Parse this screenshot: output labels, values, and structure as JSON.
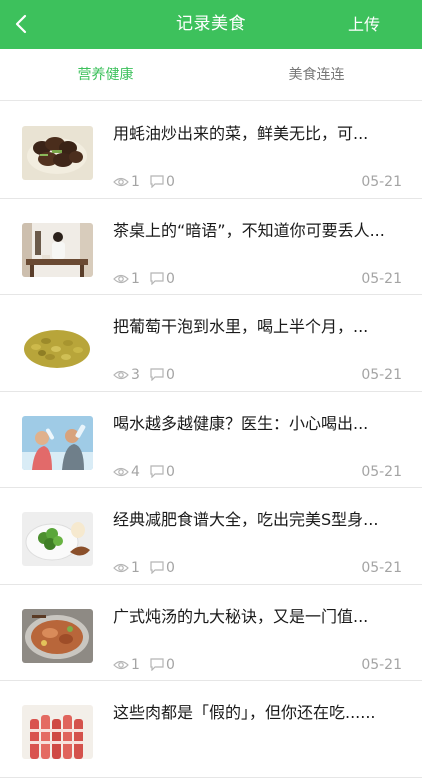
{
  "header": {
    "title": "记录美食",
    "upload_label": "上传"
  },
  "tabs": [
    {
      "label": "营养健康",
      "active": true
    },
    {
      "label": "美食连连",
      "active": false
    }
  ],
  "colors": {
    "accent": "#3dc15c",
    "meta": "#a4a4a4"
  },
  "articles": [
    {
      "title": "用蚝油炒出来的菜，鲜美无比，可...",
      "views": "1",
      "comments": "0",
      "date": "05-21",
      "thumb": "mushroom-dish"
    },
    {
      "title": "茶桌上的“暗语”，不知道你可要丢人...",
      "views": "1",
      "comments": "0",
      "date": "05-21",
      "thumb": "tea-woman"
    },
    {
      "title": "把葡萄干泡到水里，喝上半个月，...",
      "views": "3",
      "comments": "0",
      "date": "05-21",
      "thumb": "raisins"
    },
    {
      "title": "喝水越多越健康？医生：小心喝出...",
      "views": "4",
      "comments": "0",
      "date": "05-21",
      "thumb": "drinking-water"
    },
    {
      "title": "经典减肥食谱大全，吃出完美S型身...",
      "views": "1",
      "comments": "0",
      "date": "05-21",
      "thumb": "diet-plate"
    },
    {
      "title": "广式炖汤的九大秘诀，又是一门值...",
      "views": "1",
      "comments": "0",
      "date": "05-21",
      "thumb": "stew-soup"
    },
    {
      "title": "这些肉都是「假的」，但你还在吃......",
      "views": "",
      "comments": "",
      "date": "",
      "thumb": "meat-rolls"
    }
  ]
}
